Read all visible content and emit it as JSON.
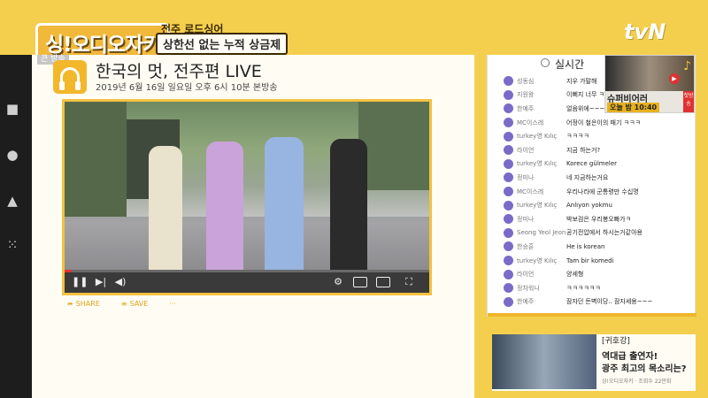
{
  "banner": {
    "show_logo": "싱!오디오자키",
    "caption_top": "전주 로드싱어",
    "caption_box": "상한선 없는 누적 상금제",
    "network": "tvN"
  },
  "main": {
    "live_tag": "큰 방송",
    "title": "한국의 멋, 전주편 LIVE",
    "date": "2019년 6월 16일 일요일 오후 6시 10분 본방송",
    "progress_percent": 2,
    "actions": [
      "SHARE",
      "SAVE",
      "···"
    ]
  },
  "chat": {
    "header": "실시간",
    "rows": [
      {
        "user": "성동심",
        "msg": "지우 가말해"
      },
      {
        "user": "지원왕",
        "msg": "이뻐지 너무 ㅋㅋㅋ"
      },
      {
        "user": "한예주",
        "msg": "얼음위에~~~"
      },
      {
        "user": "MC이스레",
        "msg": "어정이 철은이의 패기 ㅋㅋㅋ"
      },
      {
        "user": "turkey영 Kılıç",
        "msg": "ㅋㅋㅋㅋ"
      },
      {
        "user": "라이언",
        "msg": "지금 하는거?"
      },
      {
        "user": "turkey영 Kılıç",
        "msg": "Korece gülmeler"
      },
      {
        "user": "정미나",
        "msg": "네 지금하는거요"
      },
      {
        "user": "MC이스레",
        "msg": "우리나라에 군통령만 수십명"
      },
      {
        "user": "turkey영 Kılıç",
        "msg": "Anlıyon yokmu"
      },
      {
        "user": "정미나",
        "msg": "박보검은 우리봉오빠가ㅋ"
      },
      {
        "user": "Seong Yeol Jeon",
        "msg": "공기전압에서 하시는거같아용"
      },
      {
        "user": "한승훈",
        "msg": "He is korean"
      },
      {
        "user": "turkey영 Kılıç",
        "msg": "Tam bir komedi"
      },
      {
        "user": "라이언",
        "msg": "양세형"
      },
      {
        "user": "정차워니",
        "msg": "ㅋㅋㅋㅋㅋㅋ"
      },
      {
        "user": "한예주",
        "msg": "잠자던 돈벽이당.. 잠자세용~~~"
      }
    ]
  },
  "promo": {
    "title": "슈퍼비어러",
    "time": "오늘 밤 10:40",
    "badge": "첫방송"
  },
  "reco": {
    "title": "[귀호강]",
    "line1": "역대급 출연자!",
    "line2": "광주 최고의 목소리는?",
    "meta": "싱!오디오자키 · 조회수 22만회"
  }
}
